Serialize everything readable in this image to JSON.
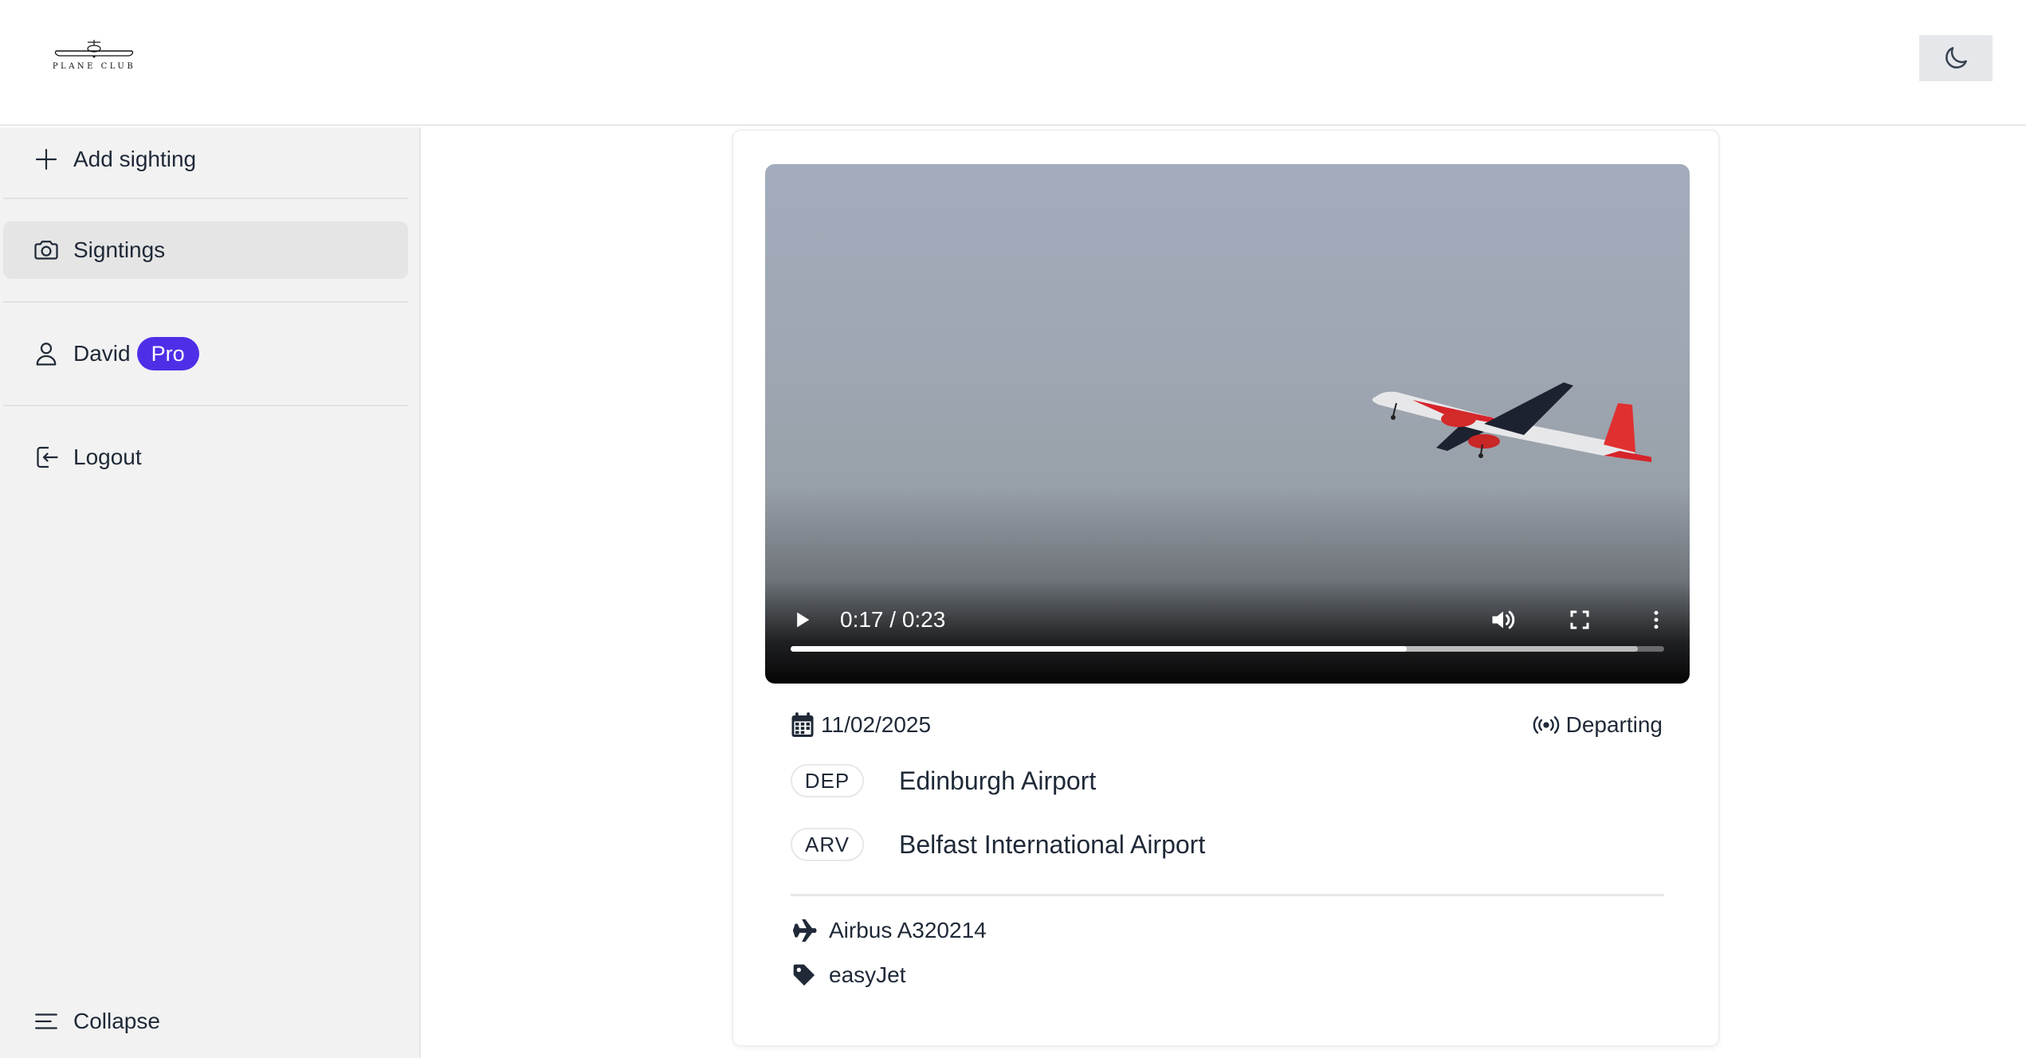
{
  "header": {
    "logo_text": "PLANE CLUB",
    "theme_toggle_icon": "moon-icon"
  },
  "sidebar": {
    "items": [
      {
        "label": "Add sighting",
        "icon": "plus-icon"
      },
      {
        "label": "Signtings",
        "icon": "camera-icon",
        "active": true
      },
      {
        "label": "David",
        "icon": "user-icon",
        "badge": "Pro"
      },
      {
        "label": "Logout",
        "icon": "logout-icon"
      }
    ],
    "collapse": {
      "label": "Collapse",
      "icon": "menu-lines-icon"
    },
    "badge_color": "#4f2ee8"
  },
  "video": {
    "time": "0:17 / 0:23",
    "progress": 0.705,
    "buffered": 0.97,
    "controls": [
      "play-icon",
      "volume-icon",
      "fullscreen-icon",
      "more-options-icon"
    ]
  },
  "sighting": {
    "date": "11/02/2025",
    "status": "Departing",
    "departure": {
      "tag": "DEP",
      "name": "Edinburgh Airport"
    },
    "arrival": {
      "tag": "ARV",
      "name": "Belfast International Airport"
    },
    "aircraft": "Airbus A320214",
    "airline": "easyJet"
  }
}
